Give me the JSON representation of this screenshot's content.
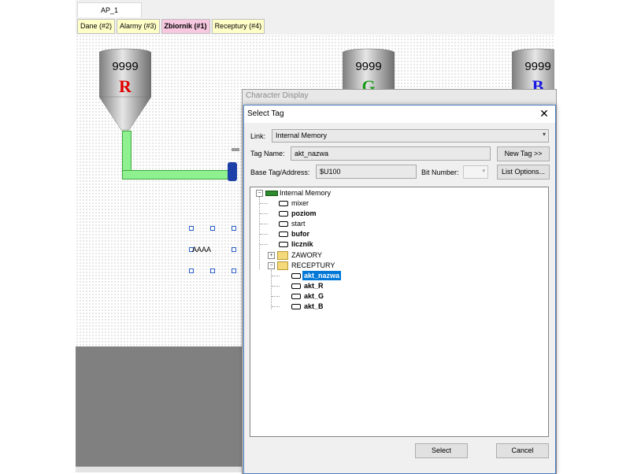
{
  "document_tab": "AP_1",
  "screen_tabs": [
    {
      "label": "Dane (#2)",
      "color": "#ffffc8"
    },
    {
      "label": "Alarmy (#3)",
      "color": "#ffffc8"
    },
    {
      "label": "Zbiornik (#1)",
      "color": "#f7c8e0"
    },
    {
      "label": "Receptury (#4)",
      "color": "#ffffc8"
    }
  ],
  "tanks": [
    {
      "value": "9999",
      "letter": "R",
      "letter_color": "#e00000"
    },
    {
      "value": "9999",
      "letter": "G",
      "letter_color": "#1a9a1a"
    },
    {
      "value": "9999",
      "letter": "B",
      "letter_color": "#1a1ae0"
    }
  ],
  "canvas_text": "AAAA",
  "outer_window_title": "Character Display",
  "dialog": {
    "title": "Select Tag",
    "close_icon": "close-icon",
    "link_label": "Link:",
    "link_value": "Internal Memory",
    "tag_name_label": "Tag Name:",
    "tag_name_value": "akt_nazwa",
    "new_tag_button": "New Tag >>",
    "base_tag_label": "Base Tag/Address:",
    "base_tag_value": "$U100",
    "bit_number_label": "Bit Number:",
    "list_options_button": "List Options...",
    "select_button": "Select",
    "cancel_button": "Cancel"
  },
  "tree": {
    "root": "Internal Memory",
    "items": [
      "mixer",
      "poziom",
      "start",
      "bufor",
      "licznik"
    ],
    "folders": [
      "ZAWORY",
      "RECEPTURY"
    ],
    "receptury_items": [
      "akt_nazwa",
      "akt_R",
      "akt_G",
      "akt_B"
    ]
  }
}
